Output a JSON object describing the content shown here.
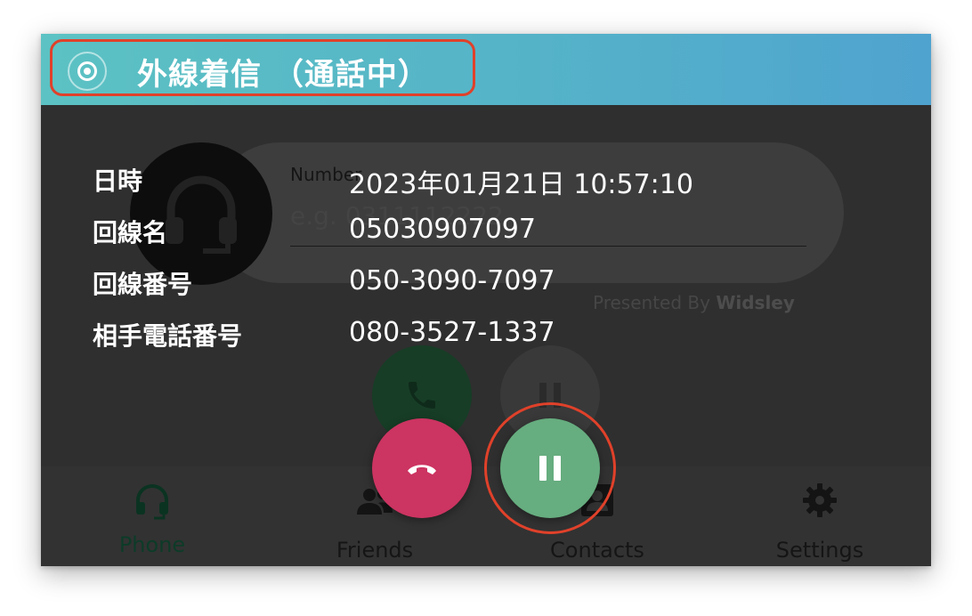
{
  "titlebar": {
    "title": "外線着信 （通話中）",
    "icon": "target-icon"
  },
  "info": {
    "rows": [
      {
        "label": "日時",
        "value": "2023年01月21日 10:57:10"
      },
      {
        "label": "回線名",
        "value": "05030907097"
      },
      {
        "label": "回線番号",
        "value": "050-3090-7097"
      },
      {
        "label": "相手電話番号",
        "value": "080-3527-1337"
      }
    ]
  },
  "actions": {
    "hangup": {
      "icon": "hangup-icon",
      "color": "#cc3461"
    },
    "hold": {
      "icon": "pause-icon",
      "color": "#66ad7f"
    }
  },
  "background_app": {
    "number_label": "Number",
    "number_placeholder": "e.g. 0311112222",
    "presented_by": "Presented By",
    "brand": "Widsley",
    "nav": [
      {
        "label": "Phone",
        "icon": "headset-icon",
        "active": true
      },
      {
        "label": "Friends",
        "icon": "people-icon",
        "active": false
      },
      {
        "label": "Contacts",
        "icon": "contacts-icon",
        "active": false
      },
      {
        "label": "Settings",
        "icon": "gear-icon",
        "active": false
      }
    ]
  },
  "colors": {
    "titlebar_start": "#5cc2c3",
    "titlebar_end": "#4fa3cf",
    "highlight": "#e0412a",
    "panel": "#2f2f2f"
  }
}
